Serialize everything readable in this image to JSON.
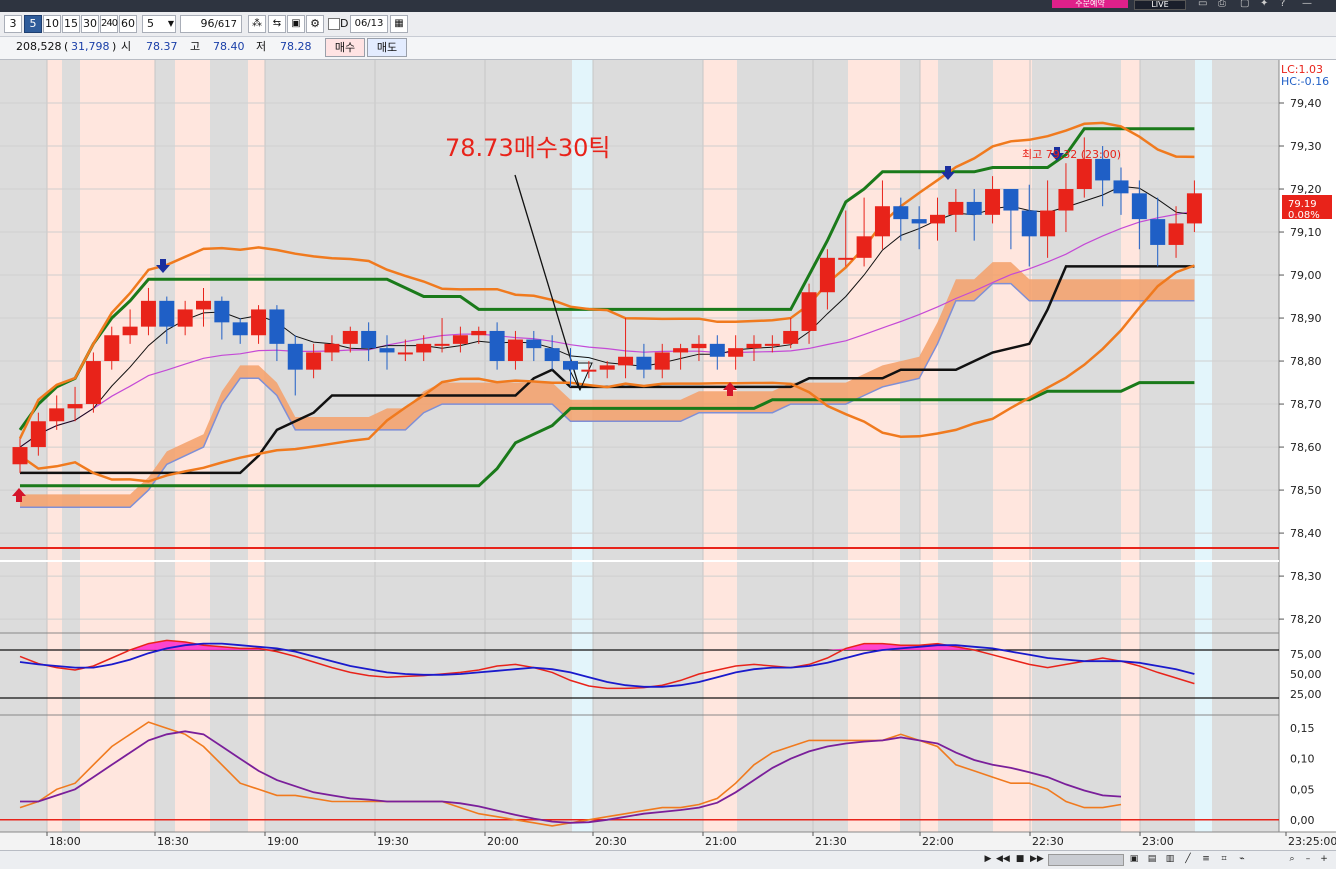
{
  "topbar": {
    "badge_label": "주문예약",
    "live_label": "LIVE",
    "icons": [
      "window-icon",
      "print-icon",
      "save-icon",
      "pin-icon",
      "help-icon",
      "minimize-icon"
    ]
  },
  "toolbar": {
    "interval_buttons": [
      "3",
      "5",
      "10",
      "15",
      "30",
      "240",
      "60"
    ],
    "active_interval": "5",
    "period_value": "5",
    "count_value": "96",
    "count_total": "/617",
    "date_checkbox_label": "D",
    "date_value": "06/13"
  },
  "quote": {
    "volume": "208,528",
    "volume_change": "31,798",
    "open_label": "시",
    "open_value": "78.37",
    "high_label": "고",
    "high_value": "78.40",
    "low_label": "저",
    "low_value": "78.28",
    "buy_label": "매수",
    "sell_label": "매도"
  },
  "chart": {
    "annotation": "78.73매수30틱",
    "high_marker": "최고 79.32 (23:00)",
    "lc_label": "LC:1.03",
    "hc_label": "HC:-0.16",
    "price_badge": "79.19",
    "change_badge": "0.08%",
    "price_ticks": [
      "79,40",
      "79,30",
      "79,20",
      "79,10",
      "79,00",
      "78,90",
      "78,80",
      "78,70",
      "78,60",
      "78,50",
      "78,40",
      "78,30",
      "78,20"
    ],
    "price_tick_values": [
      79.4,
      79.3,
      79.2,
      79.1,
      79.0,
      78.9,
      78.8,
      78.7,
      78.6,
      78.5,
      78.4,
      78.3,
      78.2
    ],
    "stoch_ticks": [
      "75,00",
      "50,00",
      "25,00"
    ],
    "macd_ticks": [
      "0,15",
      "0,10",
      "0,05",
      "0,00"
    ],
    "time_labels": [
      "18:00",
      "18:30",
      "19:00",
      "19:30",
      "20:00",
      "20:30",
      "21:00",
      "21:30",
      "22:00",
      "22:30",
      "23:00",
      "23:25:00"
    ],
    "colors": {
      "up": "#e8231a",
      "down": "#1f5fc6",
      "cloud": "#f4a06a",
      "green": "#1a7a1a",
      "orange": "#f07a1e",
      "purple": "#c44ad6"
    }
  },
  "chart_data": {
    "type": "candlestick",
    "x_time": [
      "17:45",
      "17:50",
      "17:55",
      "18:00",
      "18:05",
      "18:10",
      "18:15",
      "18:20",
      "18:25",
      "18:30",
      "18:35",
      "18:40",
      "18:45",
      "18:50",
      "18:55",
      "19:00",
      "19:05",
      "19:10",
      "19:15",
      "19:20",
      "19:25",
      "19:30",
      "19:35",
      "19:40",
      "19:45",
      "19:50",
      "19:55",
      "20:00",
      "20:05",
      "20:10",
      "20:15",
      "20:20",
      "20:25",
      "20:30",
      "20:35",
      "20:40",
      "20:45",
      "20:50",
      "20:55",
      "21:00",
      "21:05",
      "21:10",
      "21:15",
      "21:20",
      "21:25",
      "21:30",
      "21:35",
      "21:40",
      "21:45",
      "21:50",
      "21:55",
      "22:00",
      "22:05",
      "22:10",
      "22:15",
      "22:20",
      "22:25",
      "22:30",
      "22:35",
      "22:40",
      "22:45",
      "22:50",
      "22:55",
      "23:00",
      "23:05",
      "23:10",
      "23:15",
      "23:20"
    ],
    "open": [
      78.56,
      78.6,
      78.66,
      78.69,
      78.7,
      78.8,
      78.86,
      78.88,
      78.94,
      78.88,
      78.92,
      78.94,
      78.89,
      78.86,
      78.92,
      78.84,
      78.78,
      78.82,
      78.84,
      78.87,
      78.83,
      78.82,
      78.82,
      78.84,
      78.84,
      78.86,
      78.87,
      78.8,
      78.85,
      78.83,
      78.8,
      78.78,
      78.78,
      78.79,
      78.81,
      78.78,
      78.82,
      78.83,
      78.84,
      78.81,
      78.83,
      78.84,
      78.84,
      78.87,
      78.96,
      79.04,
      79.04,
      79.09,
      79.16,
      79.13,
      79.12,
      79.14,
      79.17,
      79.14,
      79.2,
      79.15,
      79.09,
      79.15,
      79.2,
      79.27,
      79.22,
      79.19,
      79.13,
      79.07,
      79.12
    ],
    "close": [
      78.6,
      78.66,
      78.69,
      78.7,
      78.8,
      78.86,
      78.88,
      78.94,
      78.88,
      78.92,
      78.94,
      78.89,
      78.86,
      78.92,
      78.84,
      78.78,
      78.82,
      78.84,
      78.87,
      78.83,
      78.82,
      78.82,
      78.84,
      78.84,
      78.86,
      78.87,
      78.8,
      78.85,
      78.83,
      78.8,
      78.78,
      78.78,
      78.79,
      78.81,
      78.78,
      78.82,
      78.83,
      78.84,
      78.81,
      78.83,
      78.84,
      78.84,
      78.87,
      78.96,
      79.04,
      79.04,
      79.09,
      79.16,
      79.13,
      79.12,
      79.14,
      79.17,
      79.14,
      79.2,
      79.15,
      79.09,
      79.15,
      79.2,
      79.27,
      79.22,
      79.19,
      79.13,
      79.07,
      79.12,
      79.19
    ],
    "high": [
      78.62,
      78.68,
      78.72,
      78.74,
      78.82,
      78.88,
      78.92,
      78.97,
      78.95,
      78.94,
      78.97,
      78.95,
      78.9,
      78.93,
      78.93,
      78.86,
      78.84,
      78.86,
      78.88,
      78.89,
      78.86,
      78.85,
      78.86,
      78.9,
      78.88,
      78.88,
      78.89,
      78.87,
      78.87,
      78.86,
      78.83,
      78.8,
      78.8,
      78.9,
      78.84,
      78.84,
      78.84,
      78.86,
      78.86,
      78.86,
      78.86,
      78.86,
      78.9,
      78.98,
      79.06,
      79.15,
      79.18,
      79.22,
      79.18,
      79.16,
      79.18,
      79.2,
      79.2,
      79.23,
      79.18,
      79.21,
      79.22,
      79.26,
      79.32,
      79.3,
      79.25,
      79.22,
      79.18,
      79.16,
      79.22
    ],
    "low": [
      78.54,
      78.58,
      78.64,
      78.66,
      78.68,
      78.78,
      78.84,
      78.86,
      78.84,
      78.86,
      78.88,
      78.85,
      78.84,
      78.84,
      78.8,
      78.72,
      78.76,
      78.8,
      78.82,
      78.8,
      78.78,
      78.8,
      78.8,
      78.82,
      78.82,
      78.84,
      78.78,
      78.78,
      78.8,
      78.78,
      78.74,
      78.76,
      78.76,
      78.76,
      78.76,
      78.76,
      78.78,
      78.8,
      78.78,
      78.78,
      78.8,
      78.82,
      78.83,
      78.84,
      78.92,
      79.02,
      79.02,
      79.06,
      79.08,
      79.06,
      79.08,
      79.1,
      79.08,
      79.12,
      79.06,
      79.02,
      79.04,
      79.1,
      79.18,
      79.16,
      79.14,
      79.06,
      79.02,
      79.04,
      79.1
    ],
    "ylim": [
      78.17,
      79.5
    ],
    "x_axis_labels": [
      "18:00",
      "18:30",
      "19:00",
      "19:30",
      "20:00",
      "20:30",
      "21:00",
      "21:30",
      "22:00",
      "22:30",
      "23:00"
    ],
    "series": [
      {
        "name": "stochastic_k",
        "values": [
          72,
          63,
          58,
          55,
          60,
          70,
          80,
          88,
          92,
          90,
          86,
          84,
          82,
          82,
          78,
          72,
          65,
          58,
          52,
          48,
          46,
          47,
          48,
          50,
          52,
          55,
          60,
          62,
          58,
          52,
          42,
          35,
          32,
          32,
          33,
          36,
          42,
          50,
          55,
          60,
          62,
          60,
          58,
          62,
          70,
          82,
          88,
          88,
          86,
          86,
          88,
          84,
          80,
          74,
          68,
          62,
          58,
          62,
          66,
          70,
          66,
          60,
          52,
          45,
          38
        ],
        "style": "red"
      },
      {
        "name": "stochastic_d",
        "values": [
          65,
          62,
          60,
          58,
          58,
          62,
          68,
          76,
          82,
          86,
          88,
          88,
          86,
          84,
          82,
          78,
          72,
          66,
          60,
          56,
          52,
          50,
          49,
          49,
          50,
          52,
          54,
          56,
          58,
          56,
          52,
          46,
          40,
          36,
          34,
          34,
          36,
          40,
          46,
          52,
          56,
          58,
          58,
          60,
          64,
          70,
          76,
          80,
          82,
          84,
          86,
          86,
          84,
          82,
          78,
          74,
          70,
          68,
          66,
          66,
          66,
          64,
          60,
          56,
          50
        ],
        "style": "blue"
      },
      {
        "name": "macd",
        "values": [
          0.02,
          0.03,
          0.05,
          0.06,
          0.09,
          0.12,
          0.14,
          0.16,
          0.15,
          0.14,
          0.12,
          0.09,
          0.06,
          0.05,
          0.04,
          0.04,
          0.035,
          0.03,
          0.03,
          0.03,
          0.03,
          0.03,
          0.03,
          0.03,
          0.02,
          0.01,
          0.005,
          0.0,
          -0.005,
          -0.01,
          -0.005,
          0.0,
          0.005,
          0.01,
          0.015,
          0.02,
          0.02,
          0.025,
          0.035,
          0.06,
          0.09,
          0.11,
          0.12,
          0.13,
          0.13,
          0.13,
          0.13,
          0.13,
          0.14,
          0.13,
          0.12,
          0.09,
          0.08,
          0.07,
          0.06,
          0.06,
          0.05,
          0.03,
          0.02,
          0.02,
          0.025
        ],
        "style": "orange"
      },
      {
        "name": "macd_signal",
        "values": [
          0.03,
          0.03,
          0.04,
          0.05,
          0.07,
          0.09,
          0.11,
          0.13,
          0.14,
          0.145,
          0.14,
          0.12,
          0.1,
          0.08,
          0.065,
          0.055,
          0.045,
          0.04,
          0.035,
          0.033,
          0.03,
          0.03,
          0.03,
          0.03,
          0.027,
          0.022,
          0.015,
          0.008,
          0.002,
          -0.003,
          -0.005,
          -0.004,
          0.0,
          0.005,
          0.01,
          0.013,
          0.016,
          0.02,
          0.028,
          0.045,
          0.065,
          0.085,
          0.1,
          0.112,
          0.12,
          0.125,
          0.128,
          0.13,
          0.135,
          0.13,
          0.125,
          0.11,
          0.098,
          0.09,
          0.085,
          0.078,
          0.07,
          0.058,
          0.048,
          0.04,
          0.038
        ],
        "style": "purple"
      }
    ]
  }
}
